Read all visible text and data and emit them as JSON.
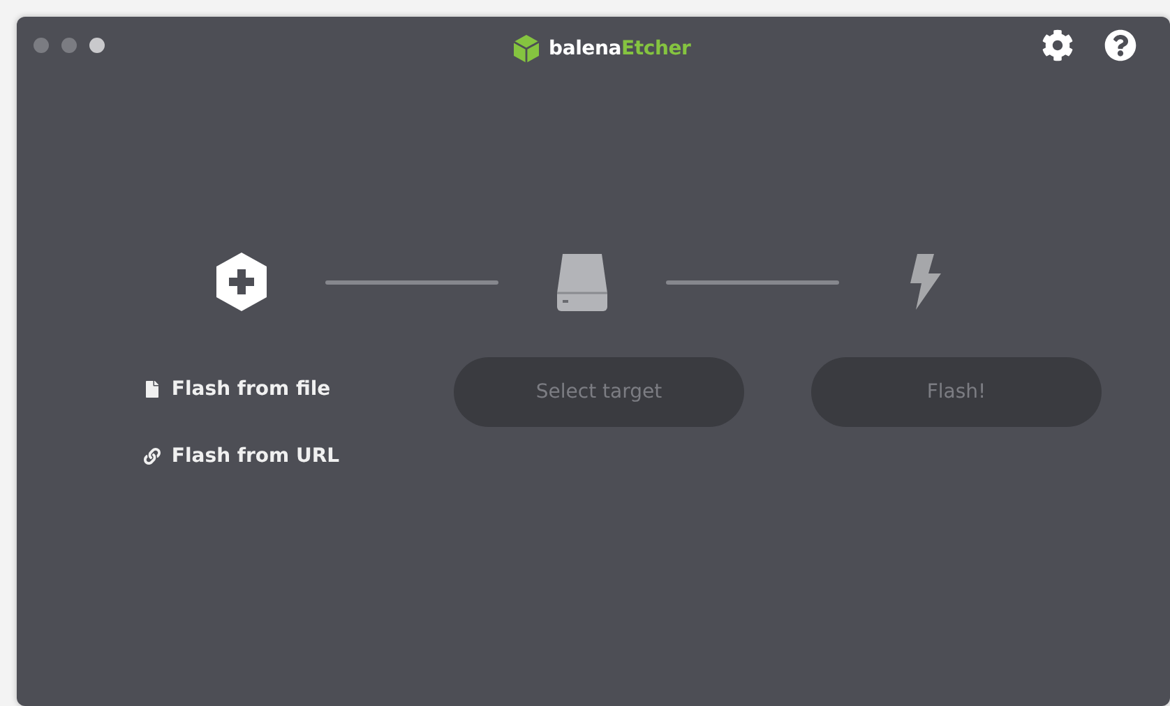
{
  "window": {
    "title": {
      "brand": "balena",
      "product": "Etcher"
    }
  },
  "steps": [
    {
      "kind": "source",
      "links": [
        {
          "kind": "file",
          "label": "Flash from file"
        },
        {
          "kind": "url",
          "label": "Flash from URL"
        }
      ]
    },
    {
      "kind": "drive",
      "button": {
        "label": "Select target",
        "disabled": true
      }
    },
    {
      "kind": "flash",
      "button": {
        "label": "Flash!",
        "disabled": true
      }
    }
  ]
}
